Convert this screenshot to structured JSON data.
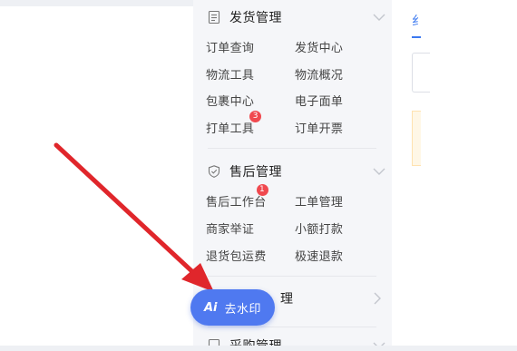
{
  "sidebar": {
    "sections": [
      {
        "title": "发货管理",
        "icon": "document-icon",
        "items": [
          {
            "label": "订单查询"
          },
          {
            "label": "发货中心"
          },
          {
            "label": "物流工具"
          },
          {
            "label": "物流概况"
          },
          {
            "label": "包裹中心"
          },
          {
            "label": "电子面单"
          },
          {
            "label": "打单工具",
            "badge": "3"
          },
          {
            "label": "订单开票"
          }
        ]
      },
      {
        "title": "售后管理",
        "icon": "shield-check-icon",
        "items": [
          {
            "label": "售后工作台",
            "badge": "1"
          },
          {
            "label": "工单管理"
          },
          {
            "label": "商家举证"
          },
          {
            "label": "小额打款"
          },
          {
            "label": "退货包运费"
          },
          {
            "label": "极速退款"
          }
        ]
      },
      {
        "title_partial": "理",
        "icon": "chevron-right-icon"
      },
      {
        "title_partial": "采购管理",
        "icon": "document-icon"
      }
    ]
  },
  "right_panel": {
    "tab_partial": "纟"
  },
  "watermark_button": {
    "icon": "Ai",
    "label": "去水印"
  },
  "colors": {
    "accent": "#3c79f0",
    "badge": "#f0494f",
    "arrow": "#e0262b",
    "button": "#4f79f0"
  }
}
